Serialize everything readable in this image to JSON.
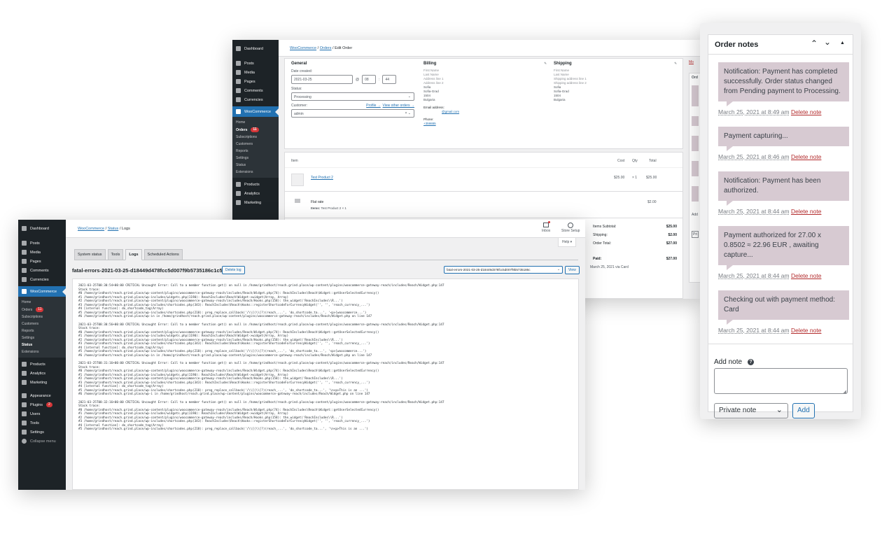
{
  "order_window": {
    "sidebar": {
      "dashboard": "Dashboard",
      "posts": "Posts",
      "media": "Media",
      "pages": "Pages",
      "comments": "Comments",
      "currencies": "Currencies",
      "woocommerce": "WooCommerce",
      "sub": {
        "home": "Home",
        "orders": "Orders",
        "orders_count": "11",
        "subscriptions": "Subscriptions",
        "customers": "Customers",
        "reports": "Reports",
        "settings": "Settings",
        "status": "Status",
        "extensions": "Extensions"
      },
      "products": "Products",
      "analytics": "Analytics",
      "marketing": "Marketing"
    },
    "breadcrumb": {
      "woocommerce": "WooCommerce",
      "orders": "Orders",
      "current": "Edit Order"
    },
    "general": {
      "heading": "General",
      "date_label": "Date created:",
      "date_value": "2021-03-25",
      "at": "@",
      "hour": "08",
      "minute": "44",
      "status_label": "Status:",
      "status_value": "Processing",
      "customer_label": "Customer:",
      "profile_link": "Profile →",
      "other_orders_link": "View other orders →",
      "customer_value": "admin"
    },
    "billing": {
      "heading": "Billing",
      "lines": [
        "First Name",
        "Last Name",
        "Address line 1",
        "Address line 2"
      ],
      "city_lines": [
        "Sofia",
        "Sofia-Grad",
        "1504",
        "Bulgaria"
      ],
      "email_label": "Email address:",
      "email_value": "@gmail.com",
      "phone_label": "Phone:",
      "phone_value": "+359885"
    },
    "shipping": {
      "heading": "Shipping",
      "lines": [
        "First Name",
        "Last Name",
        "Shipping address line 1",
        "Shipping address line 2"
      ],
      "city_lines": [
        "Sofia",
        "Sofia-Grad",
        "1504",
        "Bulgaria"
      ]
    },
    "items": {
      "col_item": "Item",
      "col_cost": "Cost",
      "col_qty": "Qty",
      "col_total": "Total",
      "product_name": "Test Product 2",
      "product_cost": "$25.00",
      "product_qty": "× 1",
      "product_total": "$25.00",
      "shipping_name": "Flat rate",
      "shipping_items_label": "Items:",
      "shipping_items_value": "Test Product 2 × 1",
      "shipping_total": "$2.00"
    },
    "totals": {
      "subtotal_label": "Items Subtotal:",
      "subtotal_value": "$25.00",
      "shipping_label": "Shipping:",
      "shipping_value": "$2.00",
      "order_total_label": "Order Total:",
      "order_total_value": "$27.00",
      "paid_label": "Paid:",
      "paid_value": "$27.00",
      "paid_note": "March 25, 2021 via Card"
    },
    "right_col": {
      "more_link": "Mo",
      "ord": "Ord",
      "add": "Add",
      "pri": "Pri"
    }
  },
  "logs_window": {
    "sidebar": {
      "dashboard": "Dashboard",
      "posts": "Posts",
      "media": "Media",
      "pages": "Pages",
      "comments": "Comments",
      "currencies": "Currencies",
      "woocommerce": "WooCommerce",
      "sub": {
        "home": "Home",
        "orders": "Orders",
        "orders_count": "11",
        "subscriptions": "Subscriptions",
        "customers": "Customers",
        "reports": "Reports",
        "settings": "Settings",
        "status": "Status",
        "extensions": "Extensions"
      },
      "products": "Products",
      "analytics": "Analytics",
      "marketing": "Marketing",
      "appearance": "Appearance",
      "plugins": "Plugins",
      "plugins_count": "2",
      "users": "Users",
      "tools": "Tools",
      "settings": "Settings",
      "collapse": "Collapse menu"
    },
    "breadcrumb": {
      "woocommerce": "WooCommerce",
      "status": "Status",
      "current": "Logs"
    },
    "topbar": {
      "inbox": "Inbox",
      "store_setup": "Store Setup",
      "help": "Help ▾"
    },
    "tabs": [
      "System status",
      "Tools",
      "Logs",
      "Scheduled Actions"
    ],
    "active_tab": "Logs",
    "log_title": "fatal-errors-2021-03-25-d18449d478fcc5d007f9b5735186c1c5.log",
    "delete_log": "Delete log",
    "log_select": "fatal-errors-2021-03-25-d18449d478fcc5d007f9b5735186c",
    "view_button": "View",
    "log_entries": [
      "2021-03-25T08:30:54+00:00 CRITICAL Uncaught Error: Call to a member function get() on null in /home/grindhost/reach.grind.place/wp-content/plugins/woocommerce-gateway-reach/includes/Reach/Widget.php:147\nStack trace:\n#0 /home/grindhost/reach.grind.place/wp-content/plugins/woocommerce-gateway-reach/includes/Reach/Widget.php(74): ReachIncludes\\Reach\\Widget::getUserSelectedCurrency()\n#1 /home/grindhost/reach.grind.place/wp-includes/widgets.php(1190): ReachIncludes\\Reach\\Widget->widget(Array, Array)\n#2 /home/grindhost/reach.grind.place/wp-content/plugins/woocommerce-gateway-reach/includes/Reach/Hooks.php(158): the_widget('ReachIncludes\\\\R...')\n#3 /home/grindhost/reach.grind.place/wp-includes/shortcodes.php(343): ReachIncludes\\Reach\\Hooks::registerShortcodeForCurrencyWidget('', '', 'reach_currency_...')\n#4 [internal function]: do_shortcode_tag(Array)\n#5 /home/grindhost/reach.grind.place/wp-includes/shortcodes.php(218): preg_replace_callback('/\\\\[(\\\\[?)(reach_...', 'do_shortcode_ta...', '<p>[woocommerce...')\n#6 /home/grindhost/reach.grind.place/wp-in in /home/grindhost/reach.grind.place/wp-content/plugins/woocommerce-gateway-reach/includes/Reach/Widget.php on line 147",
      "2021-03-25T08:30:56+00:00 CRITICAL Uncaught Error: Call to a member function get() on null in /home/grindhost/reach.grind.place/wp-content/plugins/woocommerce-gateway-reach/includes/Reach/Widget.php:147\nStack trace:\n#0 /home/grindhost/reach.grind.place/wp-content/plugins/woocommerce-gateway-reach/includes/Reach/Widget.php(74): ReachIncludes\\Reach\\Widget::getUserSelectedCurrency()\n#1 /home/grindhost/reach.grind.place/wp-includes/widgets.php(1190): ReachIncludes\\Reach\\Widget->widget(Array, Array)\n#2 /home/grindhost/reach.grind.place/wp-content/plugins/woocommerce-gateway-reach/includes/Reach/Hooks.php(158): the_widget('ReachIncludes\\\\R...')\n#3 /home/grindhost/reach.grind.place/wp-includes/shortcodes.php(343): ReachIncludes\\Reach\\Hooks::registerShortcodeForCurrencyWidget('', '', 'reach_currency_...')\n#4 [internal function]: do_shortcode_tag(Array)\n#5 /home/grindhost/reach.grind.place/wp-includes/shortcodes.php(218): preg_replace_callback('/\\\\[(\\\\[?)(reach_...', 'do_shortcode_ta...', '<p>[woocommerce...')\n#6 /home/grindhost/reach.grind.place/wp-in in /home/grindhost/reach.grind.place/wp-content/plugins/woocommerce-gateway-reach/includes/Reach/Widget.php on line 147",
      "2021-03-25T08:31:16+00:00 CRITICAL Uncaught Error: Call to a member function get() on null in /home/grindhost/reach.grind.place/wp-content/plugins/woocommerce-gateway-reach/includes/Reach/Widget.php:147\nStack trace:\n#0 /home/grindhost/reach.grind.place/wp-content/plugins/woocommerce-gateway-reach/includes/Reach/Widget.php(74): ReachIncludes\\Reach\\Widget::getUserSelectedCurrency()\n#1 /home/grindhost/reach.grind.place/wp-includes/widgets.php(1190): ReachIncludes\\Reach\\Widget->widget(Array, Array)\n#2 /home/grindhost/reach.grind.place/wp-content/plugins/woocommerce-gateway-reach/includes/Reach/Hooks.php(158): the_widget('ReachIncludes\\\\R...')\n#3 /home/grindhost/reach.grind.place/wp-includes/shortcodes.php(343): ReachIncludes\\Reach\\Hooks::registerShortcodeForCurrencyWidget('', '', 'reach_currency_...')\n#4 [internal function]: do_shortcode_tag(Array)\n#5 /home/grindhost/reach.grind.place/wp-includes/shortcodes.php(218): preg_replace_callback('/\\\\[(\\\\[?)(reach_...', 'do_shortcode_ta...', '\\n<p>This is an ...')\n#6 /home/grindhost/reach.grind.place/wp-i in /home/grindhost/reach.grind.place/wp-content/plugins/woocommerce-gateway-reach/includes/Reach/Widget.php on line 147",
      "2021-03-25T08:32:16+00:00 CRITICAL Uncaught Error: Call to a member function get() on null in /home/grindhost/reach.grind.place/wp-content/plugins/woocommerce-gateway-reach/includes/Reach/Widget.php:147\nStack trace:\n#0 /home/grindhost/reach.grind.place/wp-content/plugins/woocommerce-gateway-reach/includes/Reach/Widget.php(74): ReachIncludes\\Reach\\Widget::getUserSelectedCurrency()\n#1 /home/grindhost/reach.grind.place/wp-includes/widgets.php(1190): ReachIncludes\\Reach\\Widget->widget(Array, Array)\n#2 /home/grindhost/reach.grind.place/wp-content/plugins/woocommerce-gateway-reach/includes/Reach/Hooks.php(158): the_widget('ReachIncludes\\\\R...')\n#3 /home/grindhost/reach.grind.place/wp-includes/shortcodes.php(343): ReachIncludes\\Reach\\Hooks::registerShortcodeForCurrencyWidget('', '', 'reach_currency_...')\n#4 [internal function]: do_shortcode_tag(Array)\n#5 /home/grindhost/reach.grind.place/wp-includes/shortcodes.php(218): preg_replace_callback('/\\\\[(\\\\[?)(reach_...', 'do_shortcode_ta...', '\\n<p>This is an ...')"
    ]
  },
  "order_notes": {
    "title": "Order notes",
    "notes": [
      {
        "text": "Notification: Payment has completed successfully. Order status changed from Pending payment to Processing.",
        "time": "March 25, 2021 at 8:49 am",
        "delete": "Delete note"
      },
      {
        "text": "Payment capturing...",
        "time": "March 25, 2021 at 8:46 am",
        "delete": "Delete note"
      },
      {
        "text": "Notification: Payment has been authorized.",
        "time": "March 25, 2021 at 8:44 am",
        "delete": "Delete note"
      },
      {
        "text": "Payment authorized for 27.00 x 0.8502 ≈ 22.96 EUR , awaiting capture...",
        "time": "March 25, 2021 at 8:44 am",
        "delete": "Delete note"
      },
      {
        "text": "Checking out with payment method: Card",
        "time": "March 25, 2021 at 8:44 am",
        "delete": "Delete note"
      }
    ],
    "add_note_label": "Add note",
    "note_type": "Private note",
    "add_button": "Add"
  },
  "colors": {
    "wp_sidebar": "#1d2327",
    "wp_accent": "#2271b1",
    "note_bg": "#d7cad2",
    "delete_red": "#b32d2e"
  }
}
